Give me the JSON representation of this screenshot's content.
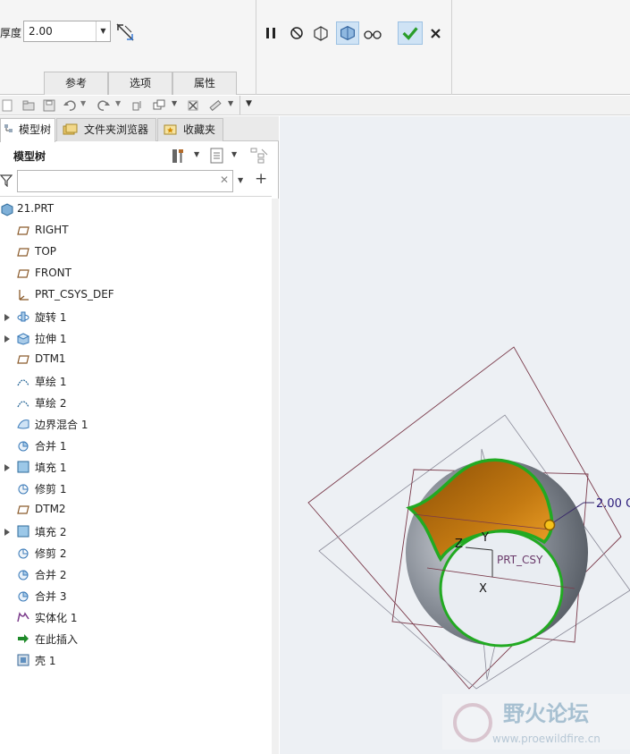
{
  "dashboard": {
    "thickness_label": "厚度",
    "thickness_value": "2.00",
    "tabs": [
      "参考",
      "选项",
      "属性"
    ]
  },
  "model_tree": {
    "panel_tabs": [
      "模型树",
      "文件夹浏览器",
      "收藏夹"
    ],
    "title": "模型树",
    "search_placeholder": "",
    "items": [
      {
        "label": "21.PRT",
        "icon": "part-icon",
        "expandable": false
      },
      {
        "label": "RIGHT",
        "icon": "datum-plane-icon",
        "expandable": false
      },
      {
        "label": "TOP",
        "icon": "datum-plane-icon",
        "expandable": false
      },
      {
        "label": "FRONT",
        "icon": "datum-plane-icon",
        "expandable": false
      },
      {
        "label": "PRT_CSYS_DEF",
        "icon": "csys-icon",
        "expandable": false
      },
      {
        "label": "旋转 1",
        "icon": "revolve-icon",
        "expandable": true
      },
      {
        "label": "拉伸 1",
        "icon": "extrude-icon",
        "expandable": true
      },
      {
        "label": "DTM1",
        "icon": "datum-plane-icon",
        "expandable": false
      },
      {
        "label": "草绘 1",
        "icon": "sketch-icon",
        "expandable": false
      },
      {
        "label": "草绘 2",
        "icon": "sketch-icon",
        "expandable": false
      },
      {
        "label": "边界混合 1",
        "icon": "boundary-blend-icon",
        "expandable": false
      },
      {
        "label": "合并 1",
        "icon": "merge-icon",
        "expandable": false
      },
      {
        "label": "填充 1",
        "icon": "fill-icon",
        "expandable": true
      },
      {
        "label": "修剪 1",
        "icon": "trim-icon",
        "expandable": false
      },
      {
        "label": "DTM2",
        "icon": "datum-plane-icon",
        "expandable": false
      },
      {
        "label": "填充 2",
        "icon": "fill-icon",
        "expandable": true
      },
      {
        "label": "修剪 2",
        "icon": "trim-icon",
        "expandable": false
      },
      {
        "label": "合并 2",
        "icon": "merge-icon",
        "expandable": false
      },
      {
        "label": "合并 3",
        "icon": "merge-icon",
        "expandable": false
      },
      {
        "label": "实体化 1",
        "icon": "solidify-icon",
        "expandable": false
      },
      {
        "label": "在此插入",
        "icon": "insert-here-arrow-icon",
        "expandable": false
      },
      {
        "label": "壳 1",
        "icon": "shell-icon",
        "expandable": false
      }
    ]
  },
  "viewport": {
    "dimension_label": "2.00 C",
    "csys_label": "PRT_CSY",
    "axis_x": "X",
    "axis_y": "Y",
    "axis_z": "Z",
    "watermark_title": "野火论坛",
    "watermark_url": "www.proewildfire.cn"
  },
  "colors": {
    "confirm_green": "#2a9d2a",
    "accent_blue": "#cfe3f5",
    "shell_inner": "#b86a0a",
    "edge_green": "#22aa22"
  }
}
